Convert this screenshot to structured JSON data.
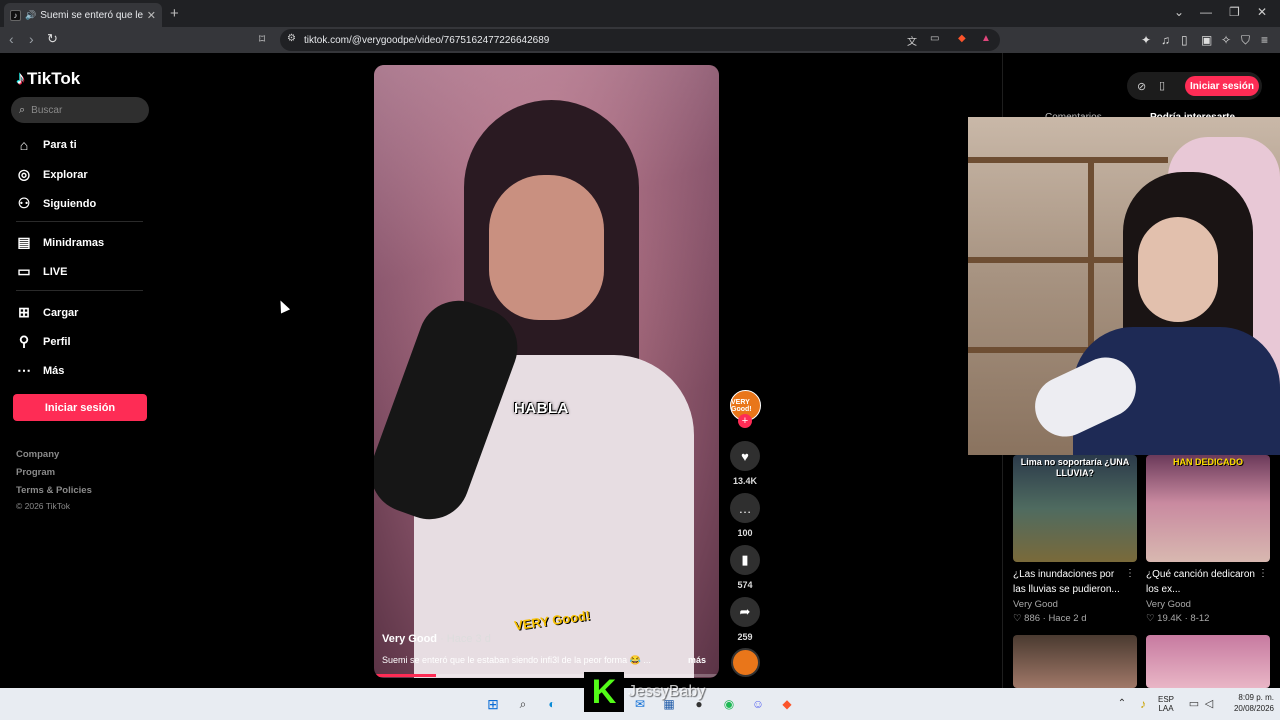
{
  "browser": {
    "tab_title": "Suemi se enteró que le estab",
    "url": "tiktok.com/@verygoodpe/video/7675162477226642689"
  },
  "sidebar": {
    "logo": "TikTok",
    "search_placeholder": "Buscar",
    "items": [
      {
        "label": "Para ti",
        "icon": "home-icon"
      },
      {
        "label": "Explorar",
        "icon": "compass-icon"
      },
      {
        "label": "Siguiendo",
        "icon": "user-follow-icon"
      },
      {
        "label": "Minidramas",
        "icon": "film-icon"
      },
      {
        "label": "LIVE",
        "icon": "tv-icon"
      },
      {
        "label": "Cargar",
        "icon": "plus-square-icon"
      },
      {
        "label": "Perfil",
        "icon": "user-icon"
      },
      {
        "label": "Más",
        "icon": "more-icon"
      }
    ],
    "login_label": "Iniciar sesión",
    "footer": [
      "Company",
      "Program",
      "Terms & Policies"
    ],
    "copyright": "© 2026 TikTok"
  },
  "video": {
    "caption_overlay": "HABLA",
    "watermark": "VERY Good!",
    "author": "Very Good",
    "time": " · Hace 3 d",
    "description": "Suemi se enteró que le estaban siendo infi3l de la peor forma 😂 ...",
    "more_label": "más",
    "progress": 0.18
  },
  "actions": {
    "avatar_text": "VERY Good!",
    "likes": "13.4K",
    "comments": "100",
    "saves": "574",
    "shares": "259"
  },
  "right_panel": {
    "login_label": "Iniciar sesión",
    "tab_comments": "Comentarios",
    "tab_related": "Podría interesarte",
    "cards": [
      {
        "thumb_text": "Lima no soportaría ¿UNA LLUVIA?",
        "title": "¿Las inundaciones por las lluvias se pudieron...",
        "channel": "Very Good",
        "meta": "♡ 886 · Hace 2 d"
      },
      {
        "thumb_text": "HAN DEDICADO",
        "title": "¿Qué canción dedicaron los ex...",
        "channel": "Very Good",
        "meta": "♡ 19.4K · 8-12"
      }
    ]
  },
  "overlay": {
    "streamer_name": "JessyBaby",
    "kick_letter": "K"
  },
  "taskbar": {
    "lang_top": "ESP",
    "lang_bottom": "LAA",
    "time": "8:09 p. m.",
    "date": "20/08/2026"
  }
}
